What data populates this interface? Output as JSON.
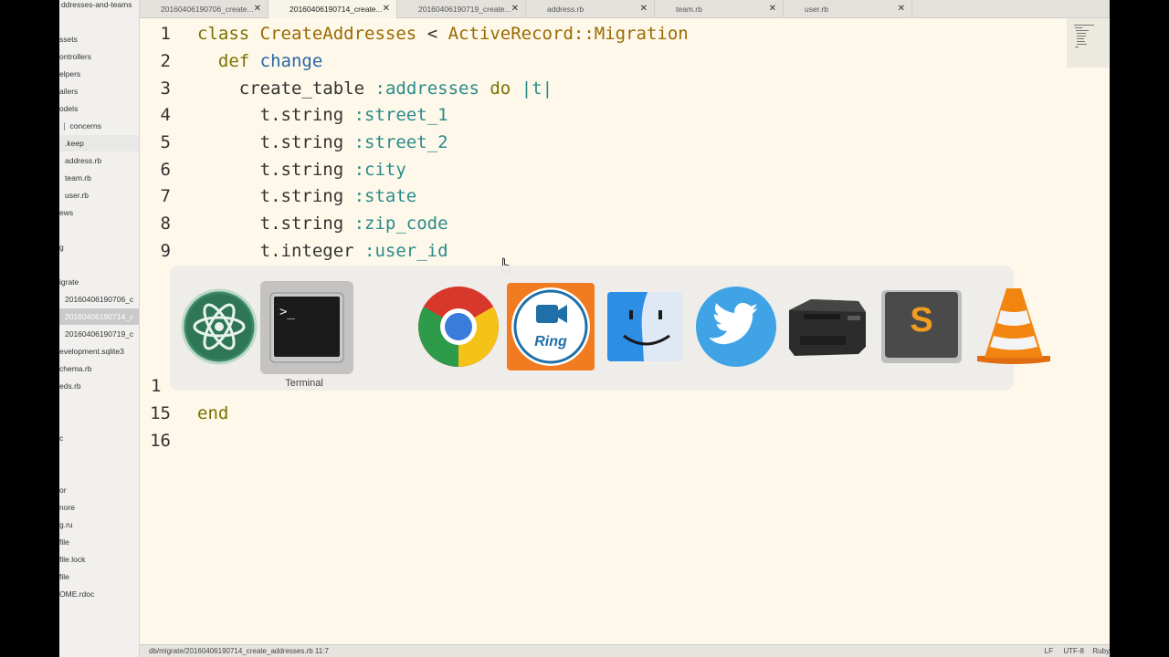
{
  "sidebar": {
    "items": [
      {
        "label": "ddresses-and-teams"
      },
      {
        "label": "ssets"
      },
      {
        "label": "ontrollers"
      },
      {
        "label": "elpers"
      },
      {
        "label": "ailers"
      },
      {
        "label": "odels"
      },
      {
        "label": "concerns"
      },
      {
        "label": ".keep"
      },
      {
        "label": "address.rb"
      },
      {
        "label": "team.rb"
      },
      {
        "label": "user.rb"
      },
      {
        "label": "ews"
      },
      {
        "label": "g"
      },
      {
        "label": "igrate"
      },
      {
        "label": "20160406190706_c"
      },
      {
        "label": "20160406190714_c"
      },
      {
        "label": "20160406190719_c"
      },
      {
        "label": "evelopment.sqlite3"
      },
      {
        "label": "chema.rb"
      },
      {
        "label": "eds.rb"
      },
      {
        "label": "c"
      },
      {
        "label": "or"
      },
      {
        "label": "nore"
      },
      {
        "label": "g.ru"
      },
      {
        "label": "file"
      },
      {
        "label": "file.lock"
      },
      {
        "label": "file"
      },
      {
        "label": "OME.rdoc"
      }
    ]
  },
  "tabs": [
    {
      "label": "20160406190706_create...",
      "close": "✕"
    },
    {
      "label": "20160406190714_create...",
      "close": "✕"
    },
    {
      "label": "20160406190719_create...",
      "close": "✕"
    },
    {
      "label": "address.rb",
      "close": "✕"
    },
    {
      "label": "team.rb",
      "close": "✕"
    },
    {
      "label": "user.rb",
      "close": "✕"
    }
  ],
  "editor": {
    "line_numbers": [
      "1",
      "2",
      "3",
      "4",
      "5",
      "6",
      "7",
      "8",
      "9",
      "1",
      "15",
      "16"
    ],
    "code": {
      "l1": {
        "kw": "class",
        "cls": "CreateAddresses",
        "op": "<",
        "parent": "ActiveRecord::Migration"
      },
      "l2": {
        "kw": "def",
        "fn": "change"
      },
      "l3": {
        "call": "create_table",
        "sym": ":addresses",
        "kw": "do",
        "param": "|t|"
      },
      "l4": {
        "call": "t.string",
        "sym": ":street_1"
      },
      "l5": {
        "call": "t.string",
        "sym": ":street_2"
      },
      "l6": {
        "call": "t.string",
        "sym": ":city"
      },
      "l7": {
        "call": "t.string",
        "sym": ":state"
      },
      "l8": {
        "call": "t.string",
        "sym": ":zip_code"
      },
      "l9": {
        "call": "t.integer",
        "sym": ":user_id"
      },
      "l15": {
        "kw": "end"
      }
    }
  },
  "statusbar": {
    "path": "db/migrate/20160406190714_create_addresses.rb   11:7",
    "line_ending": "LF",
    "encoding": "UTF-8",
    "grammar": "Ruby"
  },
  "app_switcher": {
    "selected_label": "Terminal",
    "apps": [
      {
        "icon": "atom-icon"
      },
      {
        "icon": "terminal-icon"
      },
      {
        "icon": "chrome-icon"
      },
      {
        "icon": "ring-icon",
        "text": "Ring"
      },
      {
        "icon": "finder-icon"
      },
      {
        "icon": "twitter-icon"
      },
      {
        "icon": "printer-icon"
      },
      {
        "icon": "sublime-text-icon",
        "text": "S"
      },
      {
        "icon": "vlc-icon"
      }
    ]
  },
  "colors": {
    "editor_bg": "#fdf8e9",
    "keyword": "#7a7200",
    "class_name": "#9a6a00",
    "function": "#2a66a7",
    "symbol": "#2a8b8b"
  }
}
